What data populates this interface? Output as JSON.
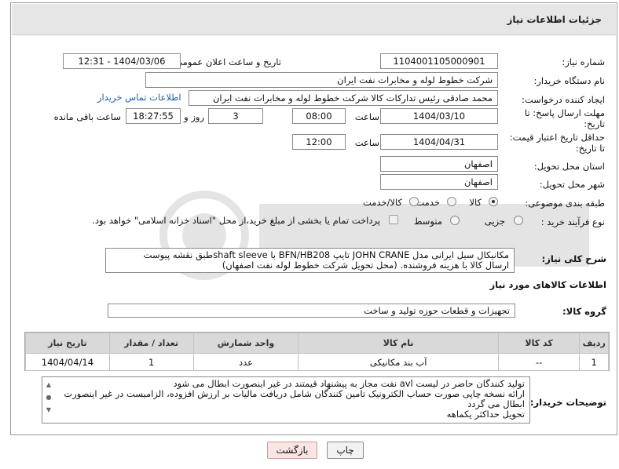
{
  "header": {
    "title": "جزئیات اطلاعات نیاز"
  },
  "form": {
    "need_number_label": "شماره نیاز:",
    "need_number": "1104001105000901",
    "announce_label": "تاریخ و ساعت اعلان عمومی:",
    "announce_value": "1404/03/06 - 12:31",
    "buyer_org_label": "نام دستگاه خریدار:",
    "buyer_org": "شرکت خطوط لوله و مخابرات نفت ایران",
    "creator_label": "ایجاد کننده درخواست:",
    "creator": "محمد صادقی رئیس تدارکات کالا  شرکت خطوط لوله و مخابرات نفت ایران",
    "contact_link": "اطلاعات تماس خریدار",
    "deadline_label_1": "مهلت ارسال پاسخ: تا",
    "deadline_label_2": "تاریخ:",
    "deadline_date": "1404/03/10",
    "time_label": "ساعت",
    "deadline_time": "08:00",
    "days_value": "3",
    "days_label": "روز و",
    "remaining_time": "18:27:55",
    "remaining_label": "ساعت باقی مانده",
    "validity_label_1": "حداقل تاریخ اعتبار قیمت:",
    "validity_label_2": "تا تاریخ:",
    "validity_date": "1404/04/31",
    "validity_time": "12:00",
    "province_label": "استان محل تحویل:",
    "province": "اصفهان",
    "city_label": "شهر محل تحویل:",
    "city": "اصفهان",
    "category_label": "طبقه بندی موضوعی:",
    "category_options": [
      "کالا",
      "خدمت",
      "کالا/خدمت"
    ],
    "process_label": "نوع فرآیند خرید :",
    "process_options": [
      "جزیی",
      "متوسط"
    ],
    "payment_note": "پرداخت تمام یا بخشی از مبلغ خرید،از محل \"اسناد خزانه اسلامی\" خواهد بود."
  },
  "description": {
    "label": "شرح کلی نیاز:",
    "line1": "مکانیکال سیل ایرانی مدل JOHN CRANE تایپ BFN/HB208  با shaft sleeveطبق نقشه پیوست",
    "line2": "ارسال کالا با هزینه فروشنده.  (محل تحویل شرکت خطوط لوله نفت اصفهان)"
  },
  "goods": {
    "section_title": "اطلاعات کالاهای مورد نیاز",
    "group_label": "گروه کالا:",
    "group_value": "تجهیزات و قطعات حوزه تولید و ساخت",
    "columns": [
      "ردیف",
      "کد کالا",
      "نام کالا",
      "واحد شمارش",
      "تعداد / مقدار",
      "تاریخ نیاز"
    ],
    "rows": [
      [
        "1",
        "--",
        "آب بند مکانیکی",
        "عدد",
        "1",
        "1404/04/14"
      ]
    ]
  },
  "buyer_notes": {
    "label": "توضیحات خریدار:",
    "line1": "تولید کنندگان حاضر در لیست avl  نفت مجاز به پیشنهاد قیمتند در غیر اینصورت ابطال می شود",
    "line2": "ارائه نسخه چاپی صورت حساب الکترونیک تامین کنندگان شامل دریافت مالیات بر ارزش افزوده، الزامیست در غیر اینصورت",
    "line3": "ابطال می گردد",
    "line4": "تحویل حداکثر یکماهه"
  },
  "buttons": {
    "print": "چاپ",
    "back": "بازگشت"
  }
}
